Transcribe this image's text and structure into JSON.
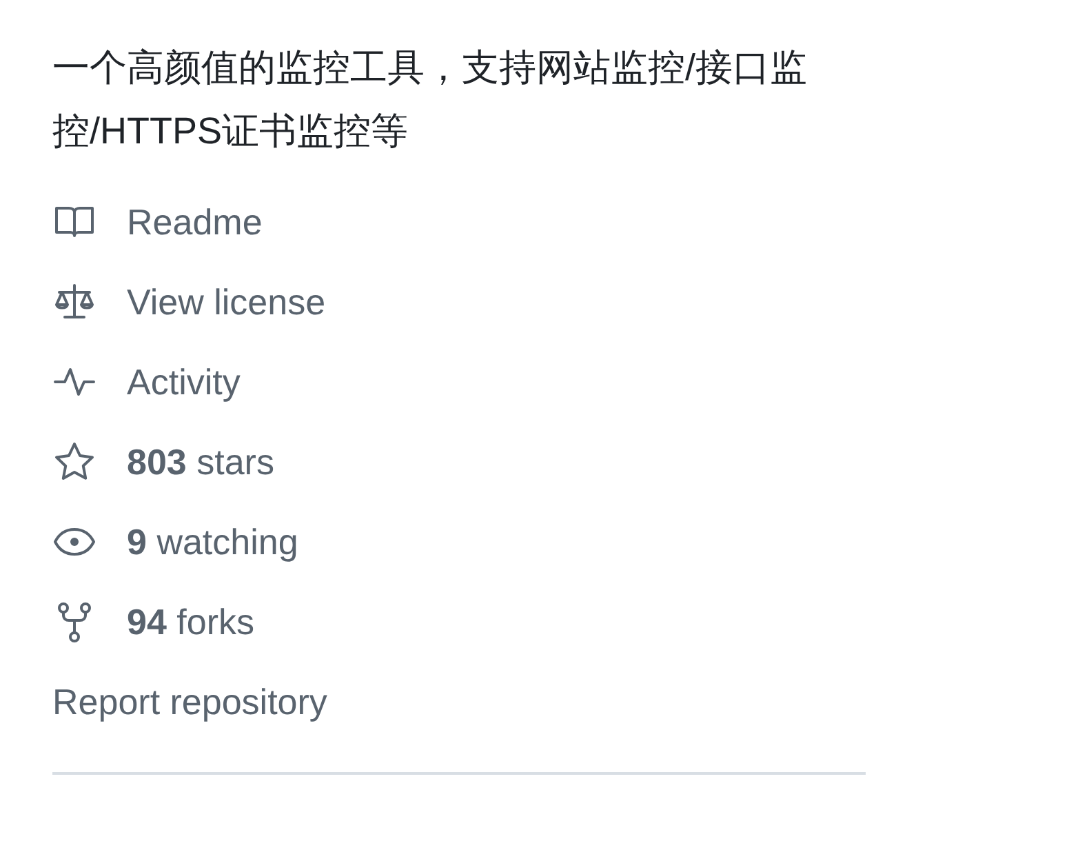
{
  "description": "一个高颜值的监控工具，支持网站监控/接口监控/HTTPS证书监控等",
  "links": [
    {
      "kind": "book",
      "label": "Readme"
    },
    {
      "kind": "scale",
      "label": "View license"
    },
    {
      "kind": "pulse",
      "label": "Activity"
    },
    {
      "kind": "star",
      "label": "**803** stars"
    },
    {
      "kind": "eye",
      "label": "**9** watching"
    },
    {
      "kind": "fork",
      "label": "**94** forks"
    }
  ],
  "report": "Report repository"
}
